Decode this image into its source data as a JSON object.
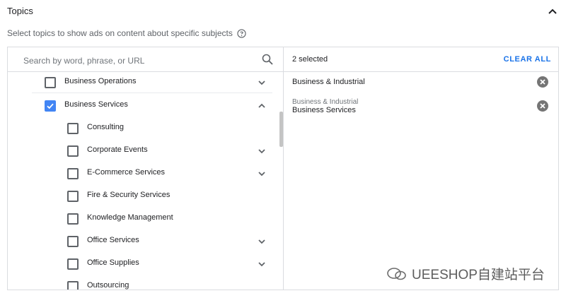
{
  "header": {
    "title": "Topics",
    "description": "Select topics to show ads on content about specific subjects"
  },
  "search": {
    "placeholder": "Search by word, phrase, or URL"
  },
  "tree": [
    {
      "label": "Business Operations",
      "checked": false,
      "expand": "down"
    },
    {
      "label": "Business Services",
      "checked": true,
      "expand": "up"
    },
    {
      "label": "Consulting",
      "checked": false,
      "expand": "none"
    },
    {
      "label": "Corporate Events",
      "checked": false,
      "expand": "down"
    },
    {
      "label": "E-Commerce Services",
      "checked": false,
      "expand": "down"
    },
    {
      "label": "Fire & Security Services",
      "checked": false,
      "expand": "none"
    },
    {
      "label": "Knowledge Management",
      "checked": false,
      "expand": "none"
    },
    {
      "label": "Office Services",
      "checked": false,
      "expand": "down"
    },
    {
      "label": "Office Supplies",
      "checked": false,
      "expand": "down"
    },
    {
      "label": "Outsourcing",
      "checked": false,
      "expand": "none"
    }
  ],
  "selected": {
    "count_label": "2 selected",
    "clear_label": "CLEAR ALL",
    "items": [
      {
        "parent": "",
        "label": "Business & Industrial"
      },
      {
        "parent": "Business & Industrial",
        "label": "Business Services"
      }
    ]
  },
  "watermark": {
    "text": "UEESHOP自建站平台"
  },
  "colors": {
    "accent": "#1a73e8",
    "checkbox_checked": "#4285f4",
    "border": "#dadce0"
  }
}
